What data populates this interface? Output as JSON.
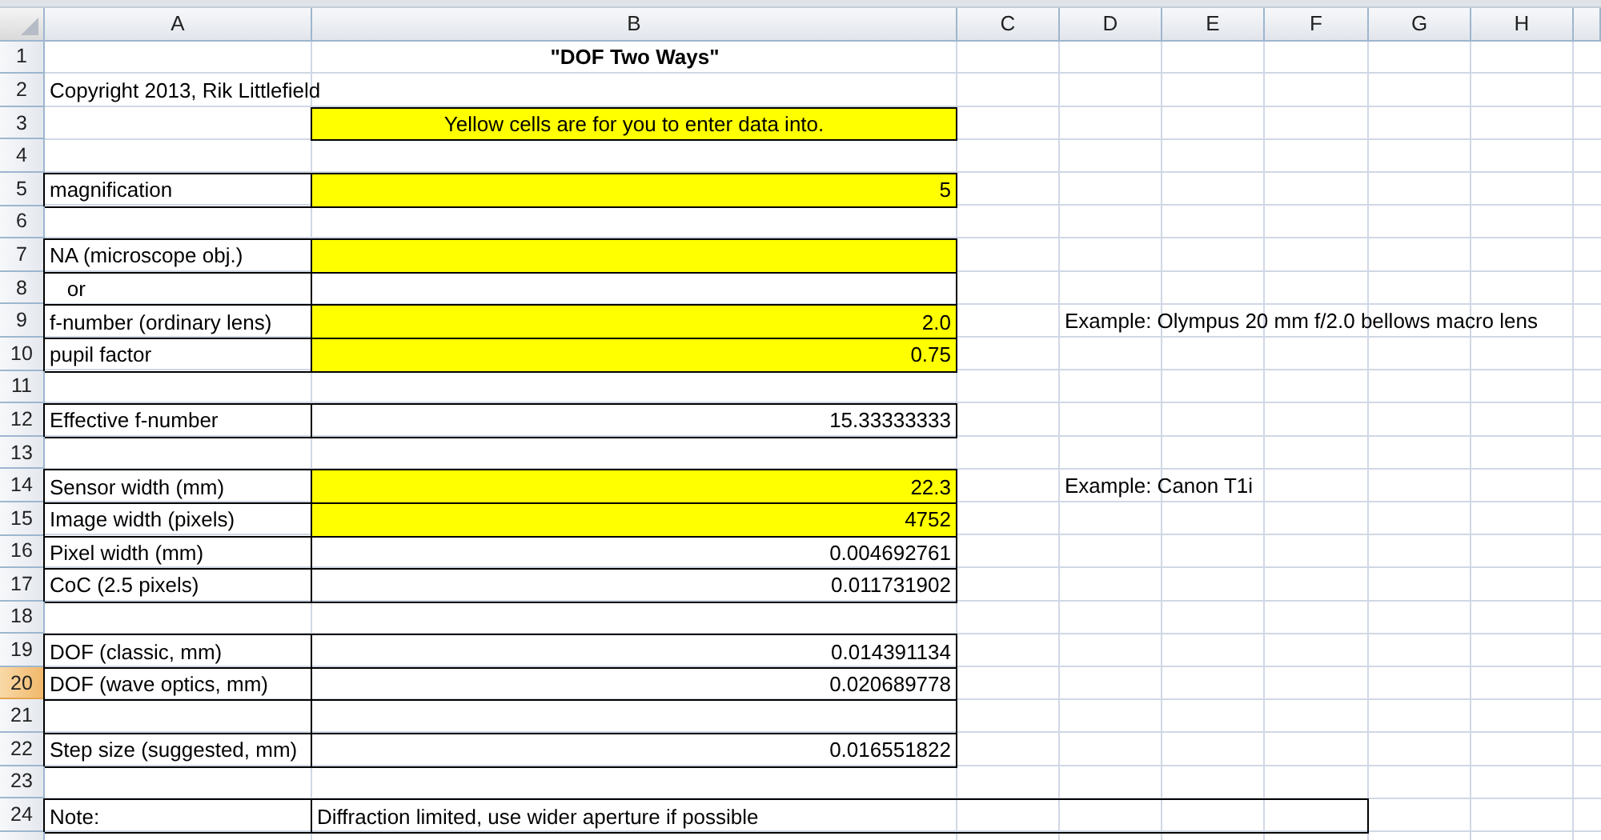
{
  "columns": [
    {
      "label": "A"
    },
    {
      "label": "B"
    },
    {
      "label": "C"
    },
    {
      "label": "D"
    },
    {
      "label": "E"
    },
    {
      "label": "F"
    },
    {
      "label": "G"
    },
    {
      "label": "H"
    }
  ],
  "rows": [
    {
      "number": "1",
      "selected": false,
      "b": {
        "text": "\"DOF Two Ways\"",
        "kind": "title"
      }
    },
    {
      "number": "2",
      "selected": false,
      "a": {
        "text": "Copyright 2013, Rik Littlefield",
        "kind": "text"
      }
    },
    {
      "number": "3",
      "selected": false,
      "b": {
        "text": "Yellow cells are for you to enter data into.",
        "kind": "center",
        "input": true,
        "boxed": true
      }
    },
    {
      "number": "4",
      "selected": false
    },
    {
      "number": "5",
      "selected": false,
      "a": {
        "text": "magnification",
        "kind": "text",
        "boxed": true
      },
      "b": {
        "text": "5",
        "kind": "number",
        "input": true,
        "boxed": true
      }
    },
    {
      "number": "6",
      "selected": false
    },
    {
      "number": "7",
      "selected": false,
      "a": {
        "text": "NA (microscope obj.)",
        "kind": "text",
        "boxed": true
      },
      "b": {
        "kind": "number",
        "input": true,
        "boxed": true
      }
    },
    {
      "number": "8",
      "selected": false,
      "a": {
        "text": "   or",
        "kind": "text",
        "boxed": true
      },
      "b": {
        "kind": "number",
        "boxed": true
      }
    },
    {
      "number": "9",
      "selected": false,
      "a": {
        "text": "f-number (ordinary lens)",
        "kind": "text",
        "boxed": true
      },
      "b": {
        "text": "2.0",
        "kind": "number",
        "input": true,
        "boxed": true
      },
      "d": {
        "text": "Example: Olympus 20 mm f/2.0 bellows macro lens",
        "kind": "text"
      }
    },
    {
      "number": "10",
      "selected": false,
      "a": {
        "text": "pupil factor",
        "kind": "text",
        "boxed": true
      },
      "b": {
        "text": "0.75",
        "kind": "number",
        "input": true,
        "boxed": true
      }
    },
    {
      "number": "11",
      "selected": false
    },
    {
      "number": "12",
      "selected": false,
      "a": {
        "text": "Effective f-number",
        "kind": "text",
        "boxed": true
      },
      "b": {
        "text": "15.33333333",
        "kind": "number",
        "boxed": true
      }
    },
    {
      "number": "13",
      "selected": false
    },
    {
      "number": "14",
      "selected": false,
      "a": {
        "text": "Sensor width (mm)",
        "kind": "text",
        "boxed": true
      },
      "b": {
        "text": "22.3",
        "kind": "number",
        "input": true,
        "boxed": true
      },
      "d": {
        "text": "Example: Canon T1i",
        "kind": "text"
      }
    },
    {
      "number": "15",
      "selected": false,
      "a": {
        "text": "Image width (pixels)",
        "kind": "text",
        "boxed": true
      },
      "b": {
        "text": "4752",
        "kind": "number",
        "input": true,
        "boxed": true
      }
    },
    {
      "number": "16",
      "selected": false,
      "a": {
        "text": "Pixel width (mm)",
        "kind": "text",
        "boxed": true
      },
      "b": {
        "text": "0.004692761",
        "kind": "number",
        "boxed": true
      }
    },
    {
      "number": "17",
      "selected": false,
      "a": {
        "text": "CoC (2.5 pixels)",
        "kind": "text",
        "boxed": true
      },
      "b": {
        "text": "0.011731902",
        "kind": "number",
        "boxed": true
      }
    },
    {
      "number": "18",
      "selected": false
    },
    {
      "number": "19",
      "selected": false,
      "a": {
        "text": "DOF (classic, mm)",
        "kind": "text",
        "boxed": true
      },
      "b": {
        "text": "0.014391134",
        "kind": "number",
        "boxed": true
      }
    },
    {
      "number": "20",
      "selected": true,
      "a": {
        "text": "DOF (wave optics, mm)",
        "kind": "text",
        "boxed": true
      },
      "b": {
        "text": "0.020689778",
        "kind": "number",
        "boxed": true
      }
    },
    {
      "number": "21",
      "selected": false,
      "a": {
        "kind": "text",
        "boxed": true
      },
      "b": {
        "kind": "number",
        "boxed": true
      }
    },
    {
      "number": "22",
      "selected": false,
      "a": {
        "text": "Step size (suggested, mm)",
        "kind": "text",
        "boxed": true
      },
      "b": {
        "text": "0.016551822",
        "kind": "number",
        "boxed": true
      }
    },
    {
      "number": "23",
      "selected": false
    },
    {
      "number": "24",
      "selected": false,
      "a": {
        "text": "Note:",
        "kind": "text",
        "boxed": true
      },
      "b": {
        "text": "Diffraction limited, use wider aperture if possible",
        "kind": "text",
        "boxed": true,
        "merged": true
      }
    }
  ]
}
